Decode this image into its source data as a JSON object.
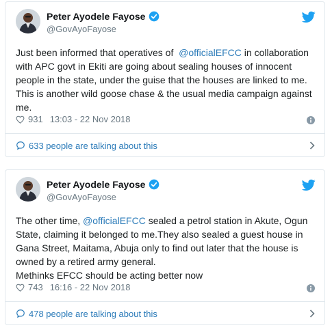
{
  "tweets": [
    {
      "display_name": "Peter Ayodele Fayose",
      "handle": "@GovAyoFayose",
      "text_before": "Just been informed that operatives of  ",
      "mention": "@officialEFCC",
      "text_after": " in collaboration with APC govt in Ekiti are going about sealing houses of innocent people in the state, under the guise that the houses are linked to me. This is another wild goose chase & the usual media campaign against me.",
      "likes": "931",
      "timestamp": "13:03 - 22 Nov 2018",
      "talking": "633 people are talking about this"
    },
    {
      "display_name": "Peter Ayodele Fayose",
      "handle": "@GovAyoFayose",
      "text_before": "The other time, ",
      "mention": "@officialEFCC",
      "text_after": " sealed a petrol station in Akute, Ogun State, claiming it belonged to me.They also sealed a guest house in Gana Street, Maitama, Abuja only to find out later that the house is owned by a retired army general.\nMethinks EFCC should be acting better now",
      "likes": "743",
      "timestamp": "16:16 - 22 Nov 2018",
      "talking": "478 people are talking about this"
    }
  ],
  "colors": {
    "link": "#2b7bb9",
    "twitter_blue": "#1da1f2",
    "muted": "#697882",
    "border": "#e1e8ed"
  },
  "icons": [
    "avatar",
    "verified-icon",
    "twitter-bird-icon",
    "heart-icon",
    "info-icon",
    "speech-bubble-icon",
    "chevron-right-icon"
  ]
}
